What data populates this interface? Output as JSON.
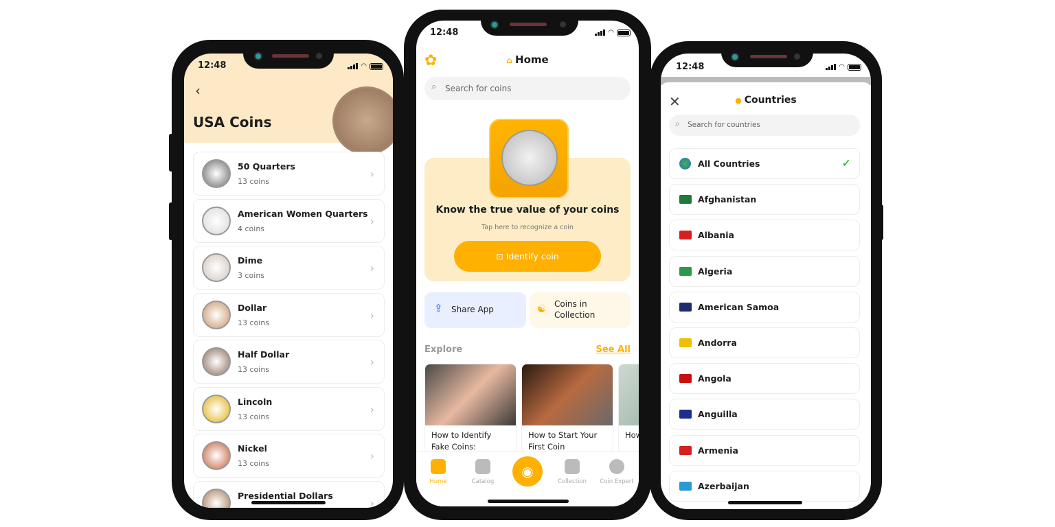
{
  "status_time": "12:48",
  "left": {
    "title": "USA Coins",
    "back_icon": "chevron-left-icon",
    "items": [
      {
        "name": "50 Quarters",
        "count": "13 coins",
        "color": "#6e6e6e"
      },
      {
        "name": "American Women Quarters",
        "count": "4 coins",
        "color": "#d9d9d9"
      },
      {
        "name": "Dime",
        "count": "3 coins",
        "color": "#cfc5bd"
      },
      {
        "name": "Dollar",
        "count": "13 coins",
        "color": "#c8946a"
      },
      {
        "name": "Half Dollar",
        "count": "13 coins",
        "color": "#8a6e5c"
      },
      {
        "name": "Lincoln",
        "count": "13 coins",
        "color": "#e0b315"
      },
      {
        "name": "Nickel",
        "count": "13 coins",
        "color": "#c6623d"
      },
      {
        "name": "Presidential Dollars",
        "count": "",
        "color": "#a67d5b"
      }
    ]
  },
  "center": {
    "title": "Home",
    "search_placeholder": "Search for coins",
    "hero_title": "Know the true value of your coins",
    "hero_subtitle": "Tap here to recognize a coin",
    "identify_button": "Identify coin",
    "share_app": "Share App",
    "coins_in_collection": "Coins in Collection",
    "explore": "Explore",
    "see_all": "See All",
    "articles": [
      {
        "title": "How to Identify Fake Coins:"
      },
      {
        "title": "How to Start Your First Coin"
      },
      {
        "title": "How to v"
      }
    ],
    "nav": [
      {
        "label": "Home",
        "active": true
      },
      {
        "label": "Catalog",
        "active": false
      },
      {
        "label": "",
        "active": false
      },
      {
        "label": "Collection",
        "active": false
      },
      {
        "label": "Coin Expert",
        "active": false
      }
    ],
    "accent": "#ffb000"
  },
  "right": {
    "title": "Countries",
    "search_placeholder": "Search for countries",
    "items": [
      {
        "name": "All Countries",
        "selected": true,
        "flag": "#2a7fd4"
      },
      {
        "name": "Afghanistan",
        "selected": false,
        "flag": "#1f7a3a"
      },
      {
        "name": "Albania",
        "selected": false,
        "flag": "#d42020"
      },
      {
        "name": "Algeria",
        "selected": false,
        "flag": "#2a9a4a"
      },
      {
        "name": "American Samoa",
        "selected": false,
        "flag": "#1c2d6b"
      },
      {
        "name": "Andorra",
        "selected": false,
        "flag": "#f0c000"
      },
      {
        "name": "Angola",
        "selected": false,
        "flag": "#c81010"
      },
      {
        "name": "Anguilla",
        "selected": false,
        "flag": "#1c2d8b"
      },
      {
        "name": "Armenia",
        "selected": false,
        "flag": "#d42020"
      },
      {
        "name": "Azerbaijan",
        "selected": false,
        "flag": "#2a9ad4"
      }
    ]
  }
}
